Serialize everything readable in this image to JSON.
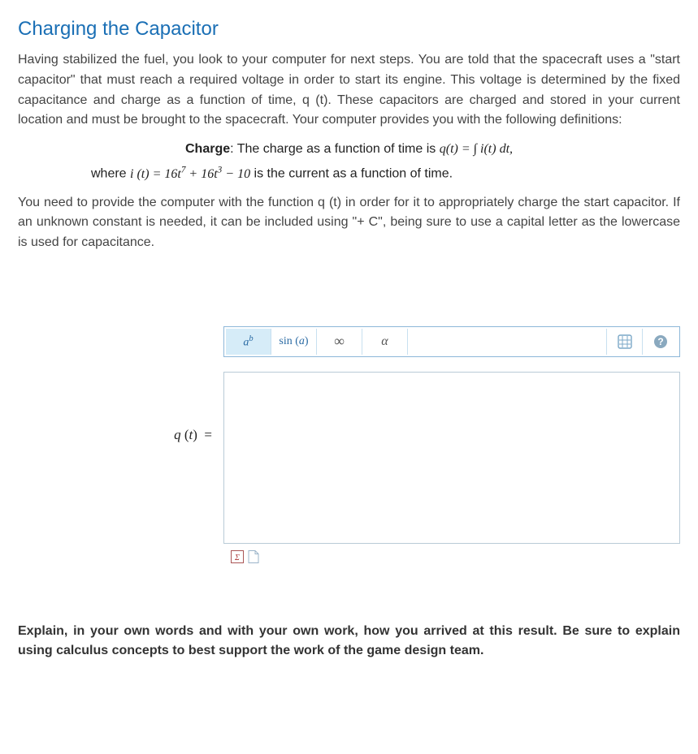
{
  "title": "Charging the Capacitor",
  "para1": "Having stabilized the fuel, you look to your computer for next steps. You are told that the spacecraft uses a \"start capacitor\" that must reach a required voltage in order to start its engine. This voltage is determined by the fixed capacitance and charge as a function of time, q (t). These capacitors are charged and stored in your current location and must be brought to the spacecraft. Your computer provides you with the following definitions:",
  "charge_label": "Charge",
  "charge_text": ": The charge as a function of time is ",
  "charge_formula": "q(t) = ∫ i(t) dt,",
  "where_text": "where ",
  "i_formula": "i (t) = 16t⁷ + 16t³ − 10",
  "current_text": " is the current as a function of time.",
  "para2": "You need to provide the computer with the function q (t) in order for it to appropriately charge the start capacitor. If an unknown constant is needed, it can be included using \"+ C\", being sure to use a capital letter as the lowercase is used for capacitance.",
  "answer_label": "q (t)   =",
  "toolbar": {
    "btn_power": "aᵇ",
    "btn_sin": "sin (a)",
    "btn_inf": "∞",
    "btn_alpha": "α"
  },
  "icons": {
    "keypad": "keypad-icon",
    "help": "help-icon",
    "equation": "equation-editor-icon",
    "page": "page-icon"
  },
  "explain": "Explain, in your own words and with your own work, how you arrived at this result. Be sure to explain using calculus concepts to best support the work of the game design team."
}
